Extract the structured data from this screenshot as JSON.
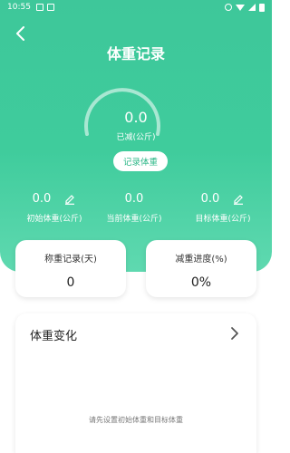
{
  "statusbar": {
    "time": "10:55"
  },
  "header": {
    "title": "体重记录"
  },
  "gauge": {
    "value": "0.0",
    "label": "已减(公斤)"
  },
  "record_button": "记录体重",
  "stats": [
    {
      "value": "0.0",
      "label": "初始体重(公斤)"
    },
    {
      "value": "0.0",
      "label": "当前体重(公斤)"
    },
    {
      "value": "0.0",
      "label": "目标体重(公斤)"
    }
  ],
  "cards": {
    "records": {
      "title": "称重记录(天)",
      "value": "0"
    },
    "progress": {
      "title": "减重进度(%)",
      "value": "0%"
    }
  },
  "change": {
    "title": "体重变化",
    "empty_text": "请先设置初始体重和目标体重"
  },
  "colors": {
    "accent": "#3fcc9c",
    "button_text": "#2fb889"
  }
}
